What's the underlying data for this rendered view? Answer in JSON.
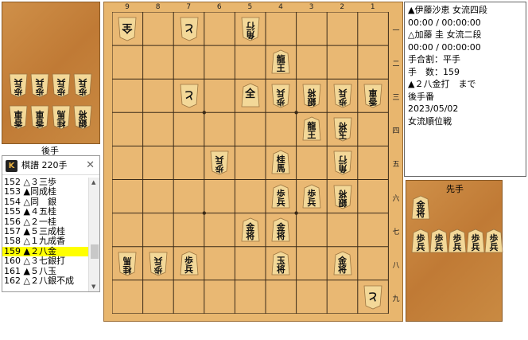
{
  "info": {
    "sente": "▲伊藤沙恵 女流四段",
    "sente_time": "00:00 / 00:00:00",
    "gote": "△加藤 圭 女流二段",
    "gote_time": "00:00 / 00:00:00",
    "handicap": "手合割：平手",
    "move_count": "手　数：159",
    "last_move": "▲２八金打　まで",
    "turn": "後手番",
    "date": "2023/05/02",
    "event": "女流順位戦"
  },
  "files": [
    "9",
    "8",
    "7",
    "6",
    "5",
    "4",
    "3",
    "2",
    "1"
  ],
  "ranks": [
    "一",
    "二",
    "三",
    "四",
    "五",
    "六",
    "七",
    "八",
    "九"
  ],
  "gote_label": "後手",
  "sente_label": "先手",
  "kifu": {
    "title": "棋譜 220手",
    "logo": "K",
    "close": "✕",
    "lines": [
      "152 △３三歩",
      "153 ▲同成桂",
      "154 △同　銀",
      "155 ▲４五桂",
      "156 △２一桂",
      "157 ▲５三成桂",
      "158 △１九成香",
      "159 ▲２八金",
      "160 △３七銀打",
      "161 ▲５八玉",
      "162 △２八銀不成"
    ],
    "selected_index": 7
  },
  "board": [
    {
      "file": 9,
      "rank": 1,
      "label": "全",
      "side": "gote"
    },
    {
      "file": 7,
      "rank": 1,
      "label": "と",
      "side": "gote"
    },
    {
      "file": 5,
      "rank": 1,
      "label": "角\n行",
      "side": "gote"
    },
    {
      "file": 4,
      "rank": 2,
      "label": "龍\n王",
      "side": "sente"
    },
    {
      "file": 7,
      "rank": 3,
      "label": "と",
      "side": "gote"
    },
    {
      "file": 5,
      "rank": 3,
      "label": "全",
      "side": "sente"
    },
    {
      "file": 4,
      "rank": 3,
      "label": "歩\n兵",
      "side": "gote"
    },
    {
      "file": 3,
      "rank": 3,
      "label": "銀\n将",
      "side": "gote"
    },
    {
      "file": 2,
      "rank": 3,
      "label": "歩\n兵",
      "side": "gote"
    },
    {
      "file": 1,
      "rank": 3,
      "label": "香\n車",
      "side": "gote"
    },
    {
      "file": 3,
      "rank": 4,
      "label": "龍\n王",
      "side": "sente"
    },
    {
      "file": 2,
      "rank": 4,
      "label": "玉\n将",
      "side": "gote"
    },
    {
      "file": 6,
      "rank": 5,
      "label": "歩\n兵",
      "side": "gote"
    },
    {
      "file": 4,
      "rank": 5,
      "label": "桂\n馬",
      "side": "sente"
    },
    {
      "file": 2,
      "rank": 5,
      "label": "角\n行",
      "side": "gote"
    },
    {
      "file": 4,
      "rank": 6,
      "label": "歩\n兵",
      "side": "sente"
    },
    {
      "file": 3,
      "rank": 6,
      "label": "歩\n兵",
      "side": "sente"
    },
    {
      "file": 2,
      "rank": 6,
      "label": "銀\n将",
      "side": "gote"
    },
    {
      "file": 5,
      "rank": 7,
      "label": "金\n将",
      "side": "sente"
    },
    {
      "file": 4,
      "rank": 7,
      "label": "金\n将",
      "side": "sente"
    },
    {
      "file": 9,
      "rank": 8,
      "label": "桂\n馬",
      "side": "gote"
    },
    {
      "file": 8,
      "rank": 8,
      "label": "歩\n兵",
      "side": "gote"
    },
    {
      "file": 7,
      "rank": 8,
      "label": "歩\n兵",
      "side": "sente"
    },
    {
      "file": 4,
      "rank": 8,
      "label": "玉\n将",
      "side": "sente"
    },
    {
      "file": 2,
      "rank": 8,
      "label": "金\n将",
      "side": "sente"
    },
    {
      "file": 1,
      "rank": 9,
      "label": "と",
      "side": "gote"
    }
  ],
  "gote_hand": [
    {
      "label": "歩\n兵",
      "row": 0,
      "col": 0
    },
    {
      "label": "歩\n兵",
      "row": 0,
      "col": 1
    },
    {
      "label": "歩\n兵",
      "row": 0,
      "col": 2
    },
    {
      "label": "歩\n兵",
      "row": 0,
      "col": 3
    },
    {
      "label": "香\n車",
      "row": 1,
      "col": 0
    },
    {
      "label": "香\n車",
      "row": 1,
      "col": 1
    },
    {
      "label": "桂\n馬",
      "row": 1,
      "col": 2
    },
    {
      "label": "銀\n将",
      "row": 1,
      "col": 3
    }
  ],
  "sente_hand": [
    {
      "label": "金\n将",
      "row": 0,
      "col": 0
    },
    {
      "label": "歩\n兵",
      "row": 1,
      "col": 0
    },
    {
      "label": "歩\n兵",
      "row": 1,
      "col": 1
    },
    {
      "label": "歩\n兵",
      "row": 1,
      "col": 2
    },
    {
      "label": "歩\n兵",
      "row": 1,
      "col": 3
    },
    {
      "label": "歩\n兵",
      "row": 1,
      "col": 4
    }
  ]
}
